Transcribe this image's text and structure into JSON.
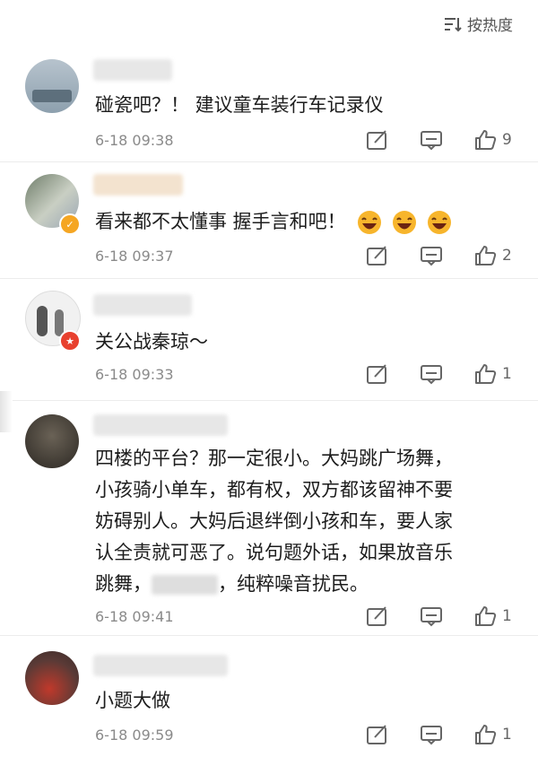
{
  "sort": {
    "label": "按热度"
  },
  "comments": [
    {
      "text": "碰瓷吧？！ 建议童车装行车记录仪",
      "time": "6-18 09:38",
      "likes": "9"
    },
    {
      "text": "看来都不太懂事 握手言和吧！",
      "time": "6-18 09:37",
      "likes": "2",
      "emoji": "laughing-face-icon"
    },
    {
      "text": "关公战秦琼～",
      "time": "6-18 09:33",
      "likes": "1"
    },
    {
      "text_lines": [
        "四楼的平台？那一定很小。大妈跳广场舞，",
        "小孩骑小单车，都有权，双方都该留神不要",
        "妨碍别人。大妈后退绊倒小孩和车，要人家",
        "认全责就可恶了。说句题外话，如果放音乐"
      ],
      "last_line_start": "跳舞，",
      "last_line_end": "，纯粹噪音扰民。",
      "time": "6-18 09:41",
      "likes": "1"
    },
    {
      "text": "小题大做",
      "time": "6-18 09:59",
      "likes": "1"
    }
  ],
  "colors": {
    "text": "#1d1d1d",
    "meta": "#8a8a8a",
    "verified_badge": "#f5a623",
    "vip_badge": "#e8412f",
    "emoji_face": "#f7b52c"
  }
}
